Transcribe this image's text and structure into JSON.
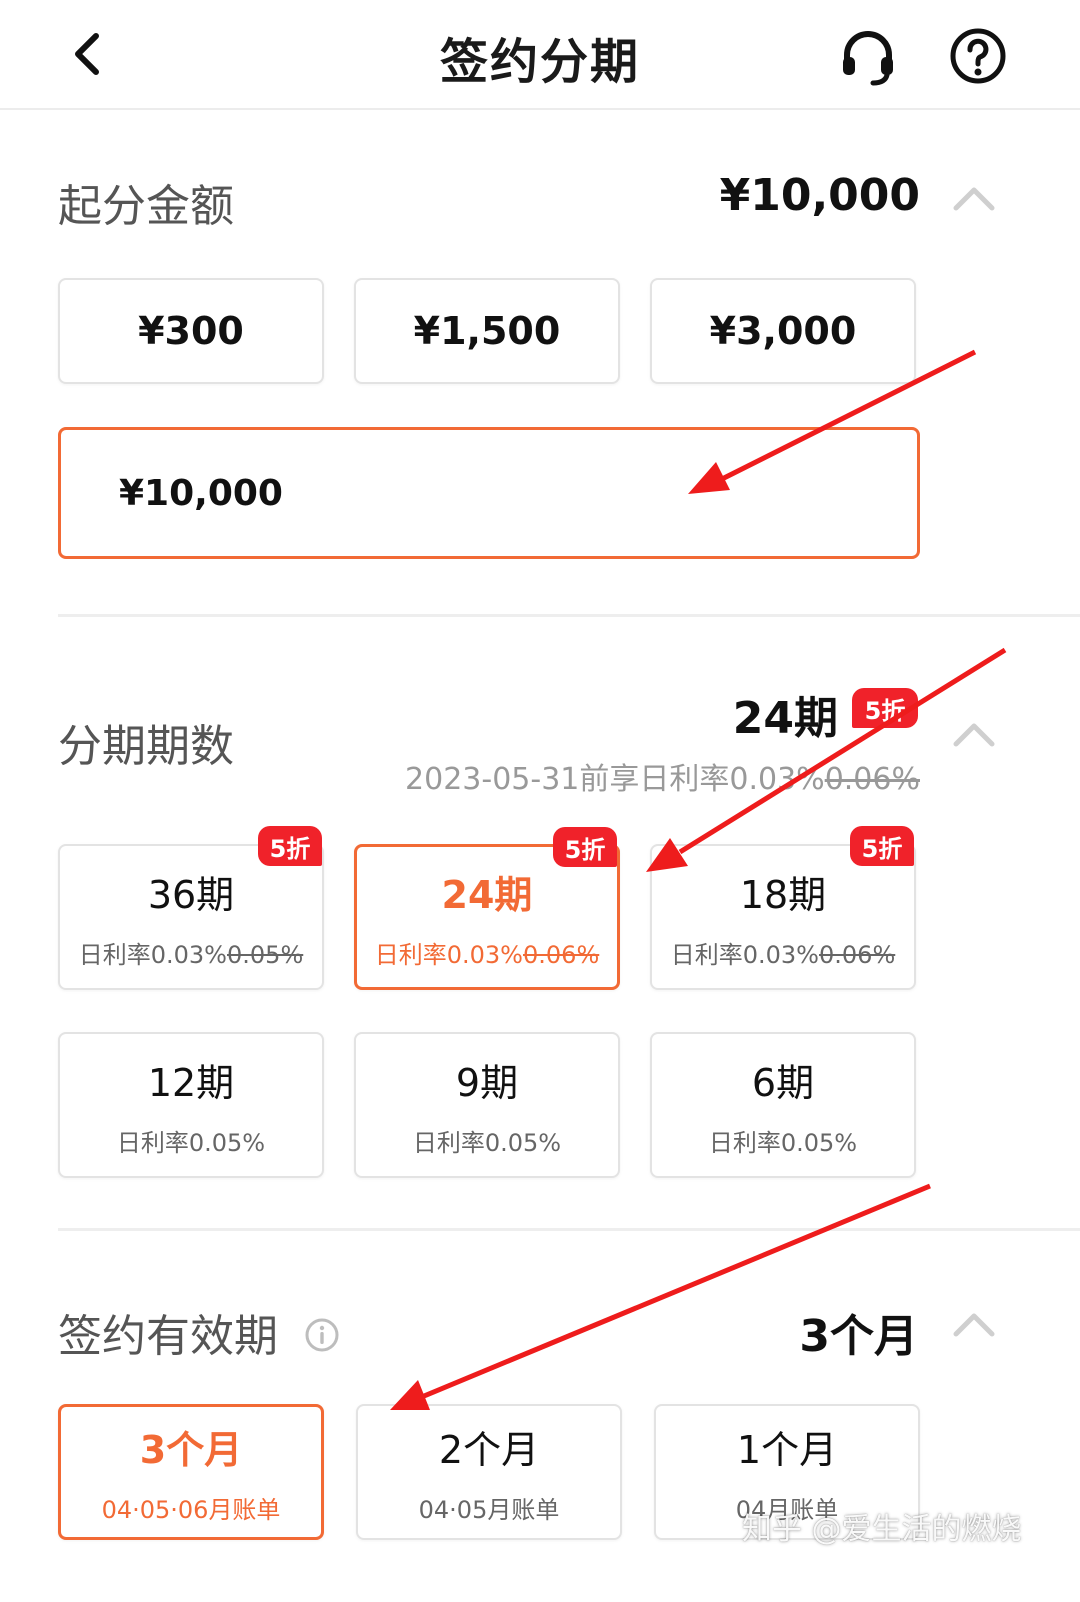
{
  "header": {
    "title": "签约分期",
    "back_icon": "chevron-left-icon",
    "service_icon": "headset-icon",
    "help_icon": "question-circle-icon"
  },
  "start_amount": {
    "label": "起分金额",
    "value": "¥10,000",
    "options": [
      "¥300",
      "¥1,500",
      "¥3,000"
    ],
    "custom_value": "¥10,000"
  },
  "installments": {
    "label": "分期期数",
    "value": "24期",
    "value_badge": "5折",
    "promo_prefix": "2023-05-31前享日利率0.03%",
    "promo_original": "0.06%",
    "options": [
      {
        "period": "36期",
        "rate": "日利率0.03%",
        "original": "0.05%",
        "badge": "5折"
      },
      {
        "period": "24期",
        "rate": "日利率0.03%",
        "original": "0.06%",
        "badge": "5折"
      },
      {
        "period": "18期",
        "rate": "日利率0.03%",
        "original": "0.06%",
        "badge": "5折"
      },
      {
        "period": "12期",
        "rate": "日利率0.05%"
      },
      {
        "period": "9期",
        "rate": "日利率0.05%"
      },
      {
        "period": "6期",
        "rate": "日利率0.05%"
      }
    ]
  },
  "validity": {
    "label": "签约有效期",
    "info_icon": "info-icon",
    "value": "3个月",
    "options": [
      {
        "term": "3个月",
        "bills": "04·05·06月账单"
      },
      {
        "term": "2个月",
        "bills": "04·05月账单"
      },
      {
        "term": "1个月",
        "bills": "04月账单"
      }
    ]
  },
  "watermark": "知乎 @爱生活的燃烧",
  "colors": {
    "accent": "#f26a35",
    "badge": "#f0222a",
    "annotation": "#ee1c1c"
  }
}
